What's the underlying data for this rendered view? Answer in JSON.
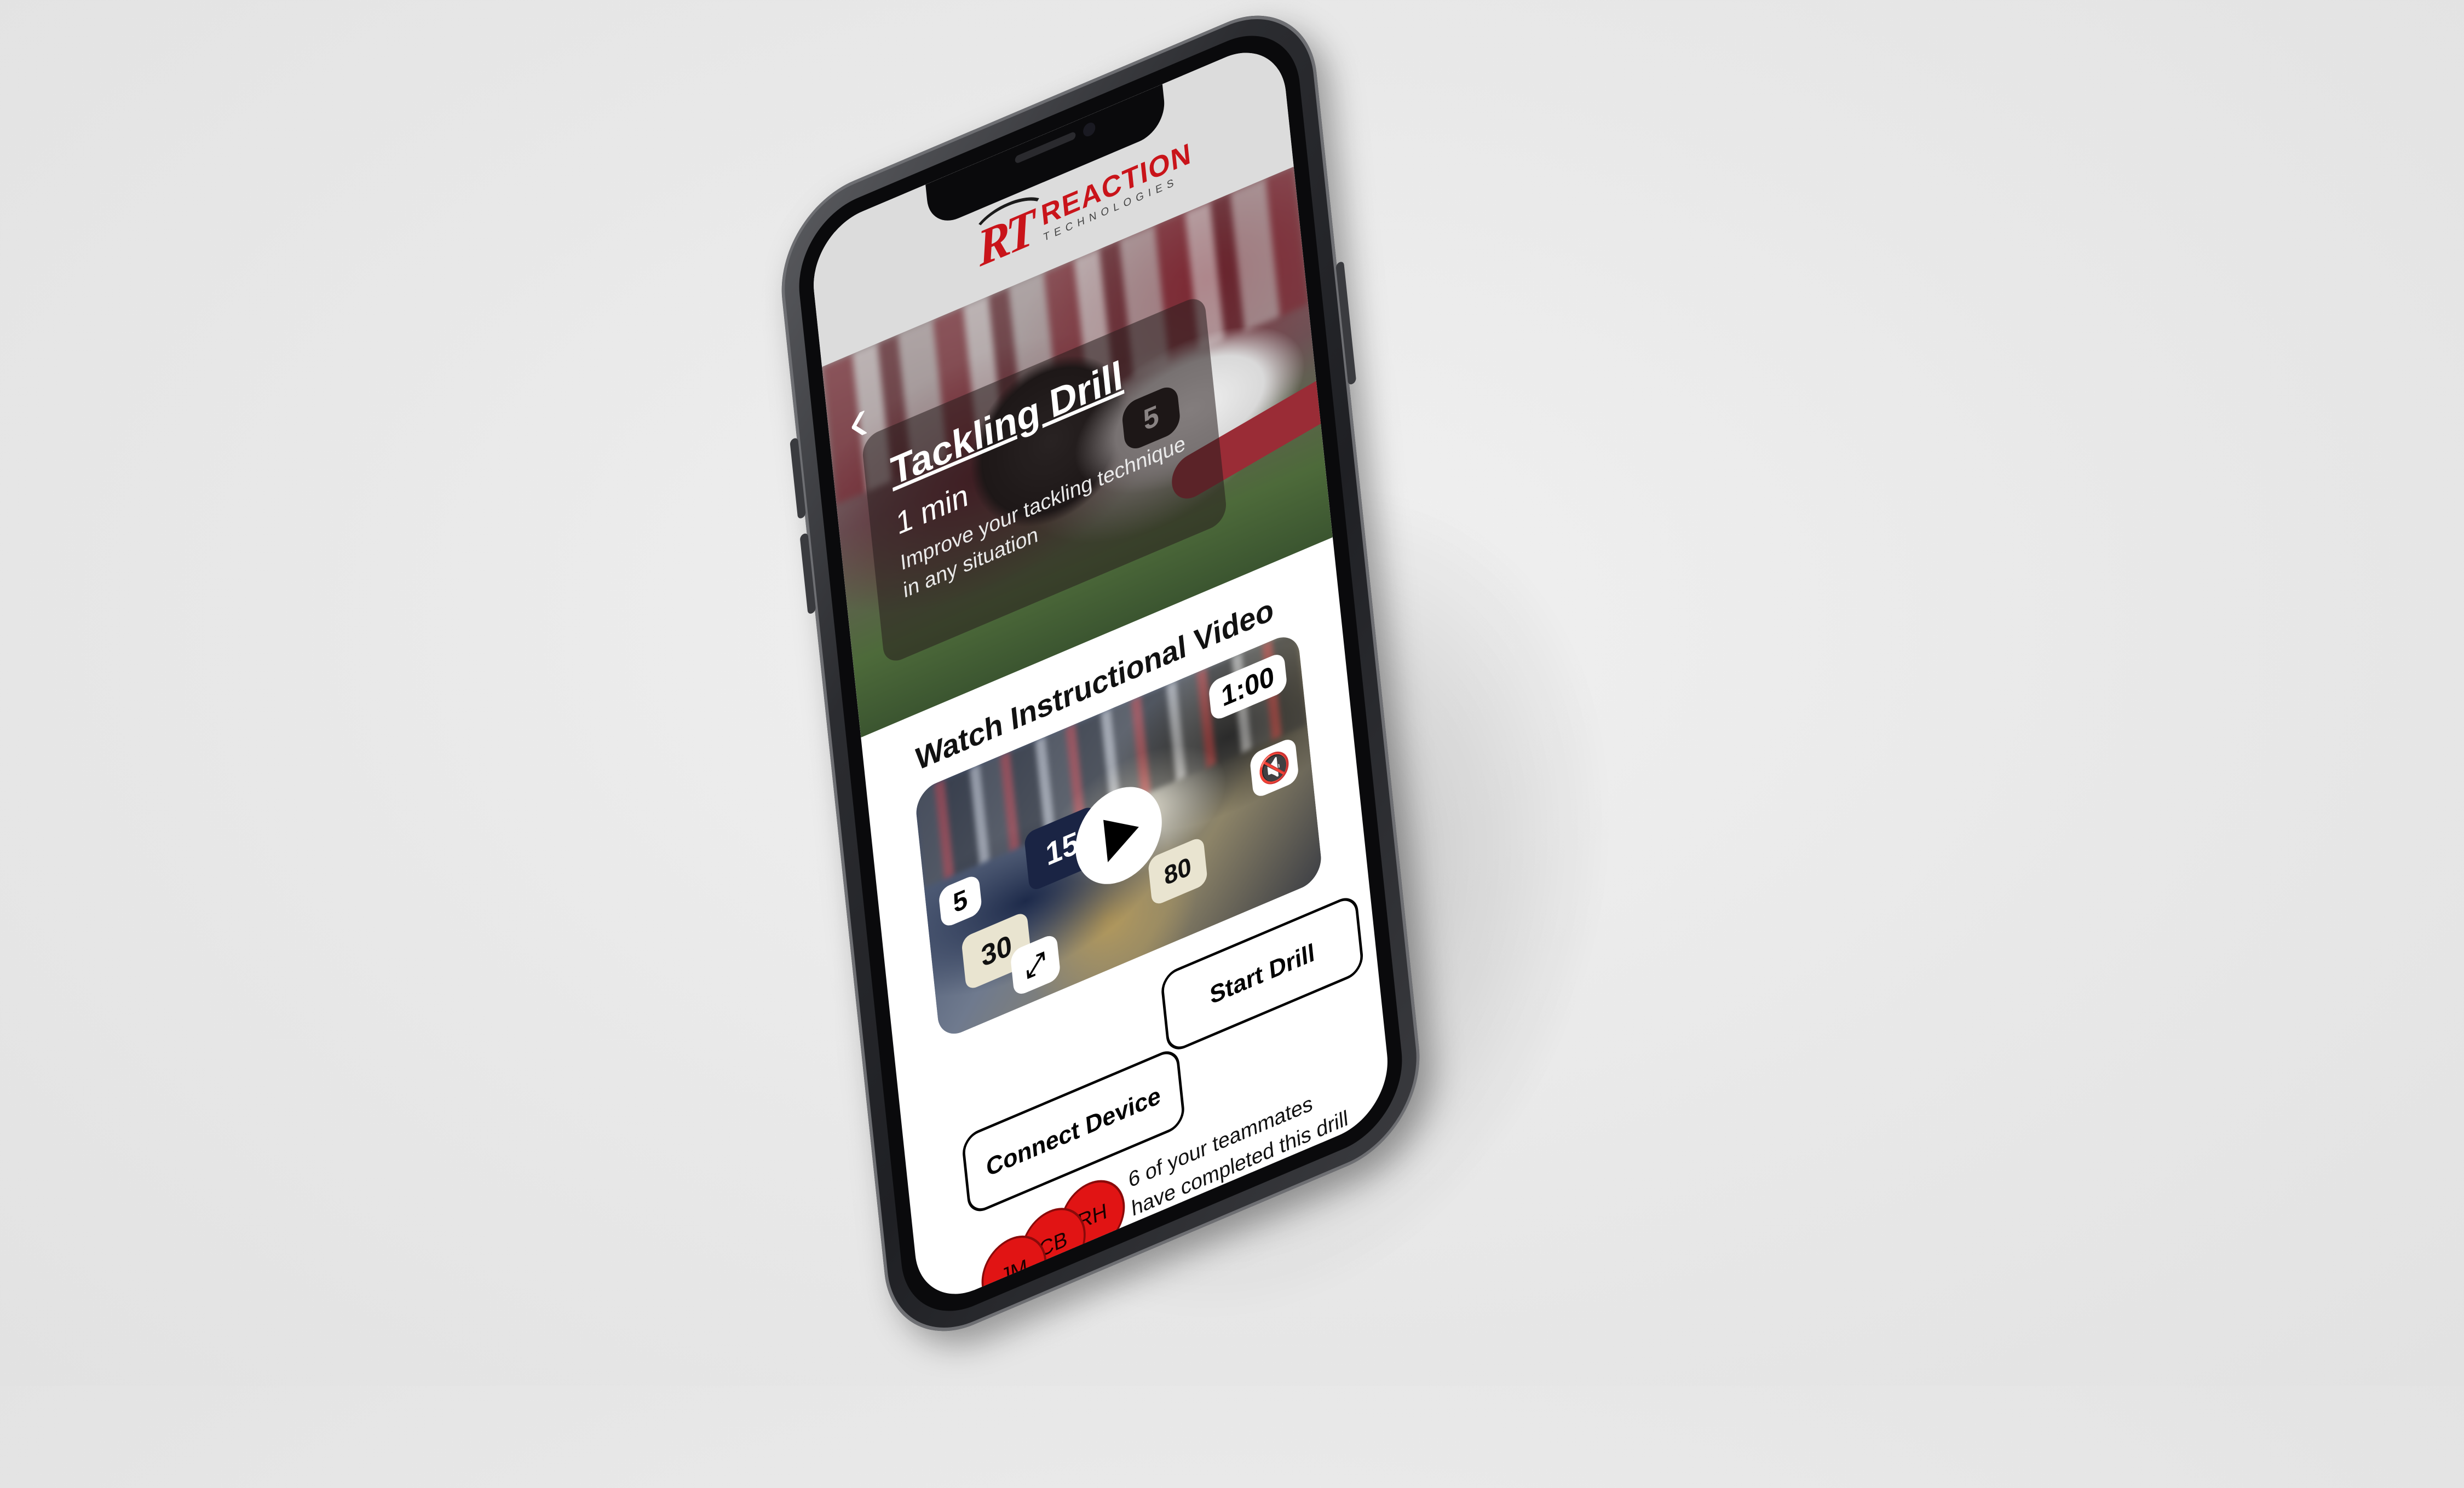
{
  "brand": {
    "mark": "RT",
    "name": "REACTION",
    "subtitle": "TECHNOLOGIES"
  },
  "hero": {
    "title": "Tackling Drill",
    "duration": "1 min",
    "description": "Improve your tackling technique in any situation",
    "jersey_number": "5",
    "back_icon": "chevron-left-icon"
  },
  "video_section": {
    "title": "Watch Instructional Video",
    "duration_badge": "1:00",
    "count_badge": "5",
    "play_icon": "play-icon",
    "mute_icon": "speaker-mute-icon",
    "expand_icon": "expand-icon",
    "jerseys": [
      "15",
      "30",
      "80"
    ]
  },
  "actions": {
    "start_label": "Start Drill",
    "connect_label": "Connect Device"
  },
  "teammates": {
    "text": "6 of your teammates have completed this drill",
    "avatars": [
      "JM",
      "CB",
      "RH"
    ],
    "avatar_color": "#e11414"
  },
  "colors": {
    "brand_red": "#c9141a",
    "background": "#e8e8e8",
    "phone_frame": "#2b2c30"
  }
}
